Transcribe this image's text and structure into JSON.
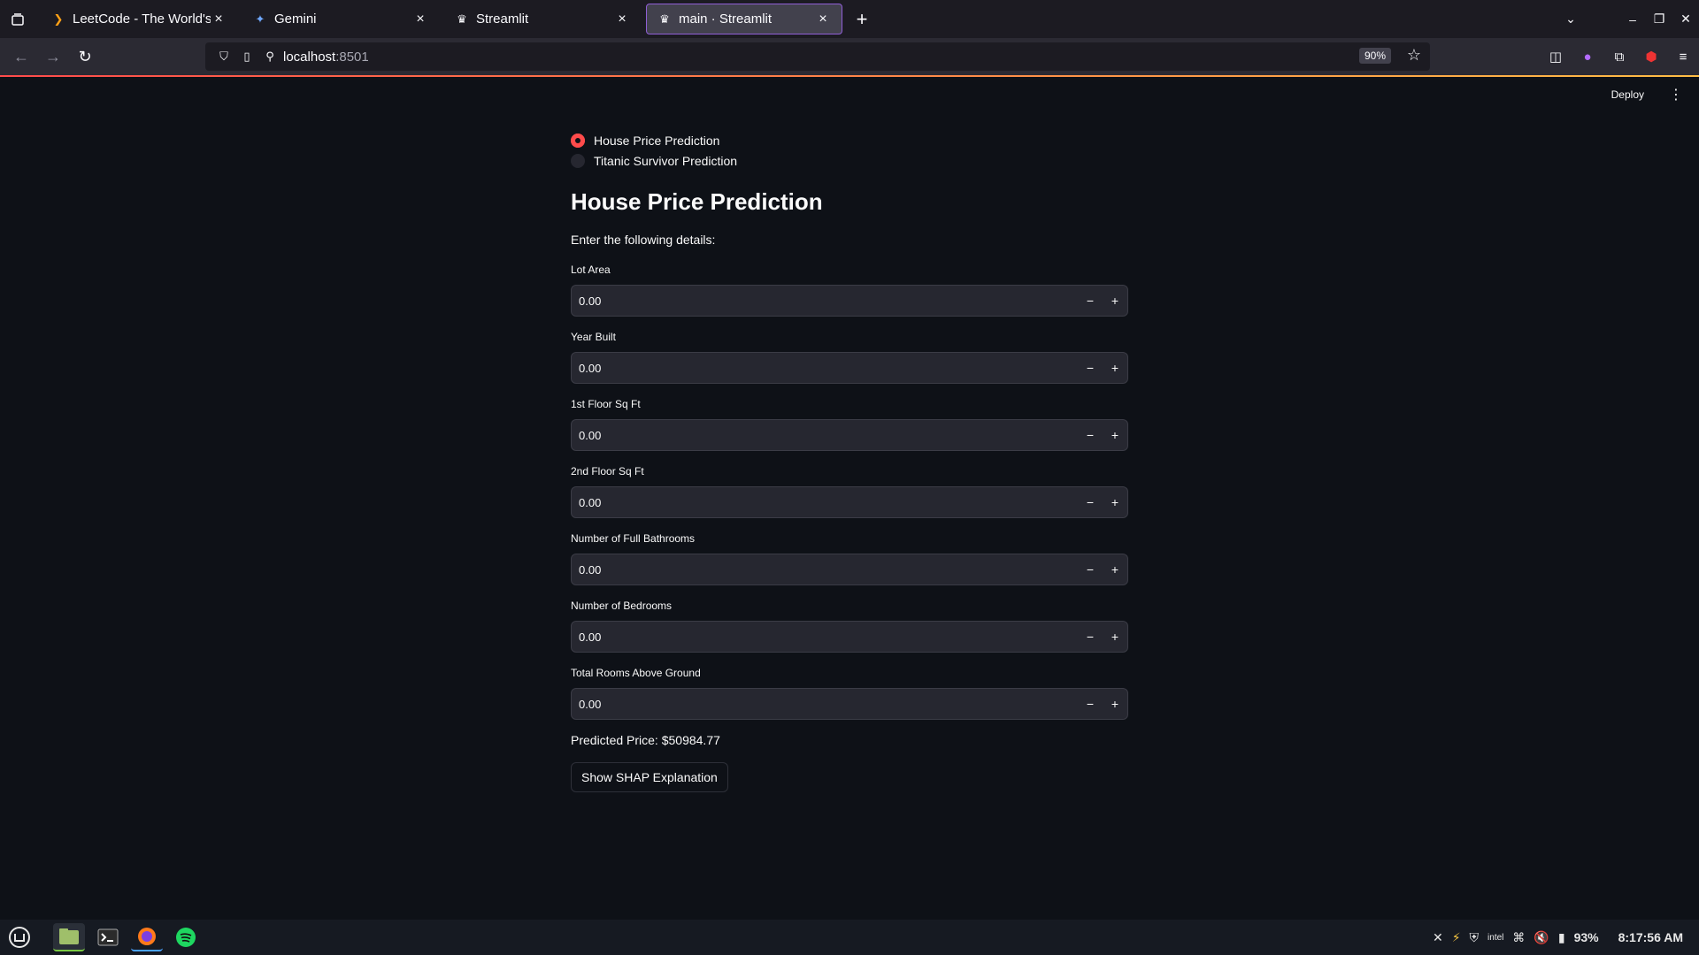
{
  "browser": {
    "tabs": [
      {
        "title": "LeetCode - The World's L",
        "icon": "leetcode-icon",
        "active": false
      },
      {
        "title": "Gemini",
        "icon": "gemini-icon",
        "active": false
      },
      {
        "title": "Streamlit",
        "icon": "streamlit-icon",
        "active": false
      },
      {
        "title": "main · Streamlit",
        "icon": "streamlit-icon",
        "active": true
      }
    ],
    "url_host": "localhost",
    "url_port": ":8501",
    "zoom": "90%",
    "accent_color": "#8f5fd6"
  },
  "app": {
    "deploy_label": "Deploy",
    "radio": [
      {
        "label": "House Price Prediction",
        "selected": true
      },
      {
        "label": "Titanic Survivor Prediction",
        "selected": false
      }
    ],
    "title": "House Price Prediction",
    "subtitle": "Enter the following details:",
    "fields": [
      {
        "label": "Lot Area",
        "value": "0.00"
      },
      {
        "label": "Year Built",
        "value": "0.00"
      },
      {
        "label": "1st Floor Sq Ft",
        "value": "0.00"
      },
      {
        "label": "2nd Floor Sq Ft",
        "value": "0.00"
      },
      {
        "label": "Number of Full Bathrooms",
        "value": "0.00"
      },
      {
        "label": "Number of Bedrooms",
        "value": "0.00"
      },
      {
        "label": "Total Rooms Above Ground",
        "value": "0.00"
      }
    ],
    "stepper_minus": "−",
    "stepper_plus": "+",
    "result": "Predicted Price: $50984.77",
    "shap_button": "Show SHAP Explanation",
    "primary_color": "#ff4b4b"
  },
  "taskbar": {
    "battery": "93%",
    "clock": "8:17:56 AM"
  }
}
